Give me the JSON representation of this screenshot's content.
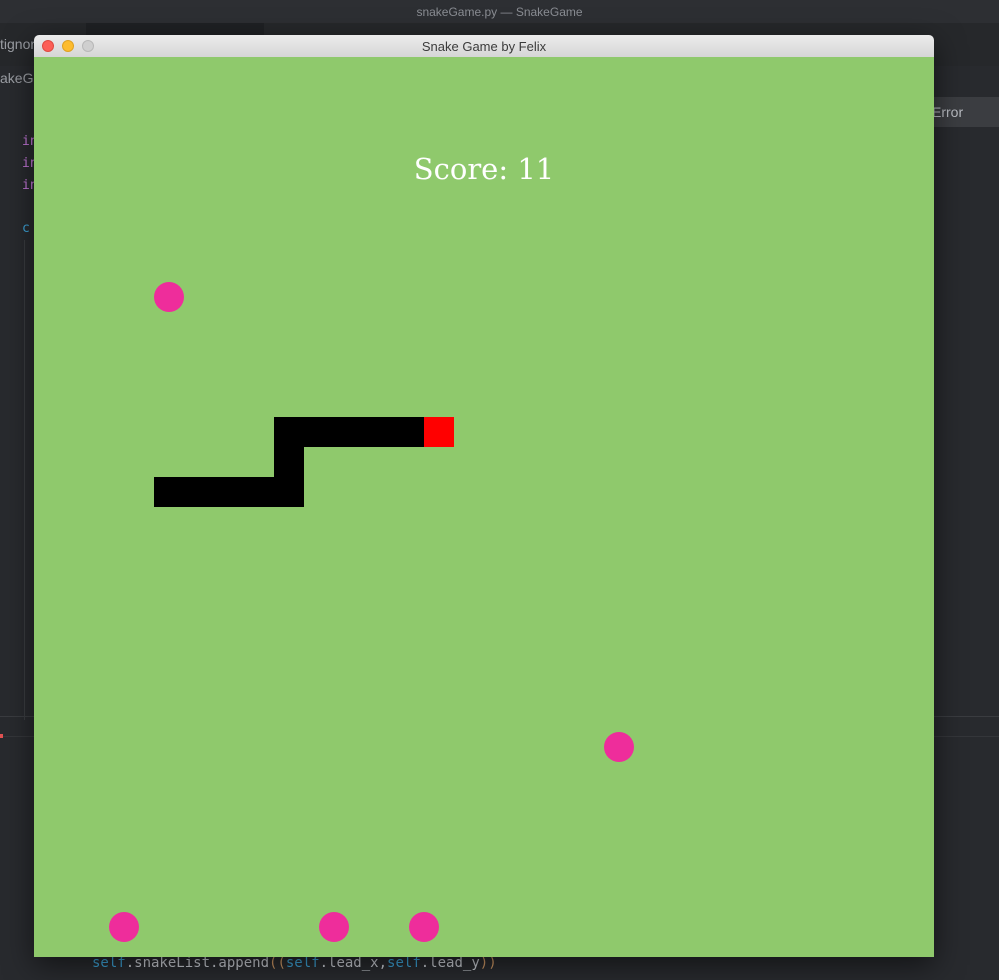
{
  "editor": {
    "window_title": "snakeGame.py — SnakeGame",
    "tab_fragment_1": "tignor",
    "tab_fragment_2": "akeG",
    "code_fragments": [
      "in",
      "in",
      "in",
      "c"
    ],
    "error_chip": "Error",
    "bottom_code": {
      "kw1": "self",
      "t1": ".snakeList.append",
      "p1": "((",
      "kw2": "self",
      "t2": ".lead_x,",
      "kw3": "self",
      "t3": ".lead_y",
      "p2": "))"
    }
  },
  "game": {
    "window_title": "Snake Game by Felix",
    "score_text": "Score: 11",
    "grid_cell": 30,
    "snake": {
      "head": [
        13,
        12
      ],
      "body": [
        [
          4,
          14
        ],
        [
          5,
          14
        ],
        [
          6,
          14
        ],
        [
          7,
          14
        ],
        [
          8,
          14
        ],
        [
          8,
          13
        ],
        [
          8,
          12
        ],
        [
          9,
          12
        ],
        [
          10,
          12
        ],
        [
          11,
          12
        ],
        [
          12,
          12
        ]
      ],
      "colors": {
        "body": "#000000",
        "head": "#ff0000"
      }
    },
    "food": [
      [
        4,
        7.5
      ],
      [
        19,
        22.5
      ],
      [
        2.5,
        28.5
      ],
      [
        9.5,
        28.5
      ],
      [
        12.5,
        28.5
      ]
    ],
    "colors": {
      "background": "#8fc96c",
      "food": "#ee2d9b",
      "score": "#ffffff"
    },
    "traffic_lights": [
      "close",
      "minimize",
      "zoom"
    ]
  }
}
